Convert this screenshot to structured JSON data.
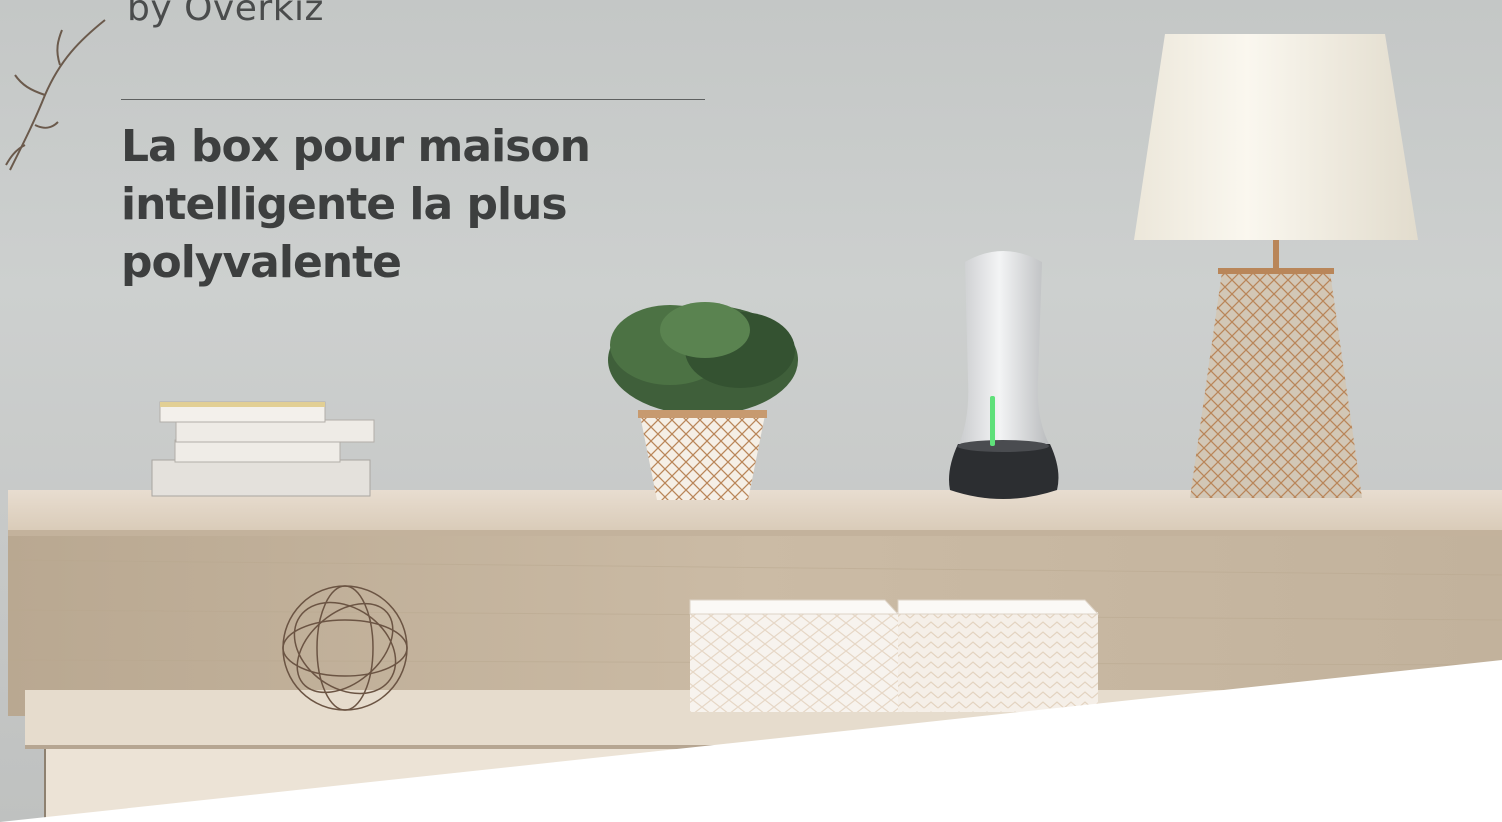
{
  "brand_subtitle": "by Overkiz",
  "headline_lines": [
    "La box pour maison",
    "intelligente la plus",
    "polyvalente"
  ],
  "colors": {
    "wall": "#c9cbca",
    "shelf_wood": "#d8c9b3",
    "headline_text": "#3d3f3f",
    "accent_green": "#5fe07a",
    "copper": "#b98659"
  }
}
